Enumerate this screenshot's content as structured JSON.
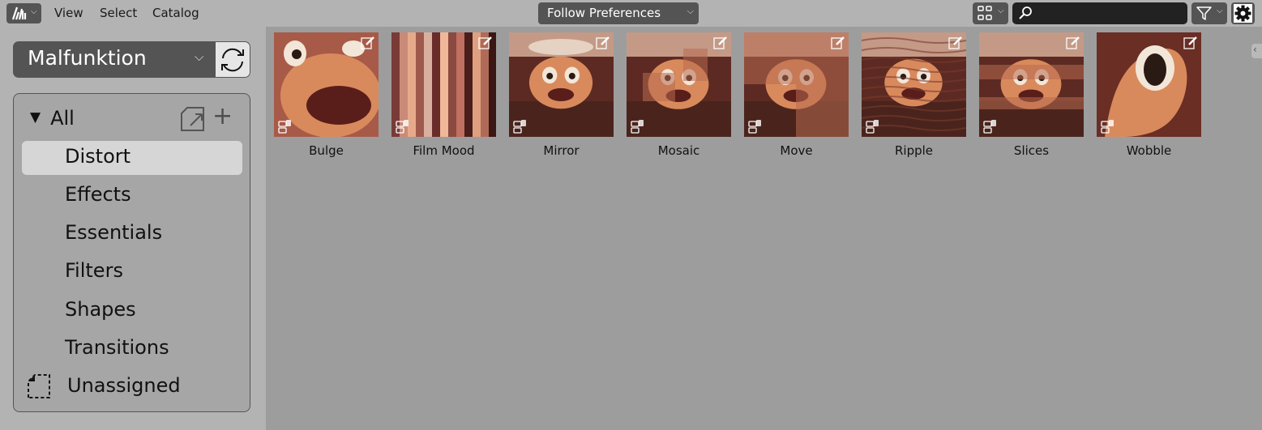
{
  "header": {
    "editor_type_icon": "asset-browser-icon",
    "menus": [
      "View",
      "Select",
      "Catalog"
    ],
    "import_method": "Follow Preferences",
    "display_mode_icon": "grid-view-icon",
    "search": {
      "value": "",
      "placeholder": ""
    },
    "filter_icon": "funnel-icon",
    "settings_icon": "gear-icon"
  },
  "sidebar": {
    "library": "Malfunktion",
    "refresh_icon": "refresh-icon",
    "root_label": "All",
    "catalogs": [
      "Distort",
      "Effects",
      "Essentials",
      "Filters",
      "Shapes",
      "Transitions"
    ],
    "active_catalog": "Distort",
    "unassigned_label": "Unassigned"
  },
  "assets": [
    {
      "name": "Bulge",
      "style": "bulge"
    },
    {
      "name": "Film Mood",
      "style": "stripes"
    },
    {
      "name": "Mirror",
      "style": "mirror"
    },
    {
      "name": "Mosaic",
      "style": "mosaic"
    },
    {
      "name": "Move",
      "style": "move"
    },
    {
      "name": "Ripple",
      "style": "ripple"
    },
    {
      "name": "Slices",
      "style": "slices"
    },
    {
      "name": "Wobble",
      "style": "wobble"
    }
  ],
  "colors": {
    "header_bg": "#b3b3b3",
    "region_bg": "#9d9d9d",
    "button_bg": "#545454",
    "active_item": "#d6d6d6"
  }
}
